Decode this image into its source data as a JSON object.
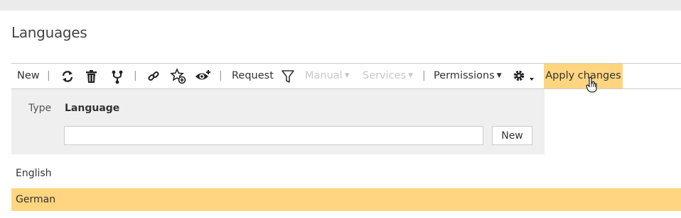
{
  "page": {
    "title": "Languages"
  },
  "toolbar": {
    "new_label": "New",
    "separator": "|",
    "request_label": "Request",
    "manual_label": "Manual",
    "services_label": "Services",
    "permissions_label": "Permissions",
    "apply_label": "Apply changes",
    "caret": "▼",
    "icons": [
      "refresh-icon",
      "delete-icon",
      "branch-icon",
      "link-icon",
      "star-add-icon",
      "watch-icon",
      "filter-icon",
      "gear-icon"
    ]
  },
  "grid": {
    "columns": [
      "Type",
      "Language"
    ],
    "filter_value": "",
    "filter_new_label": "New",
    "rows": [
      "English",
      "German"
    ],
    "selected_row": "German"
  },
  "colors": {
    "accent": "#ffd580",
    "panel": "#efefef",
    "disabled": "#c8c8c8"
  }
}
